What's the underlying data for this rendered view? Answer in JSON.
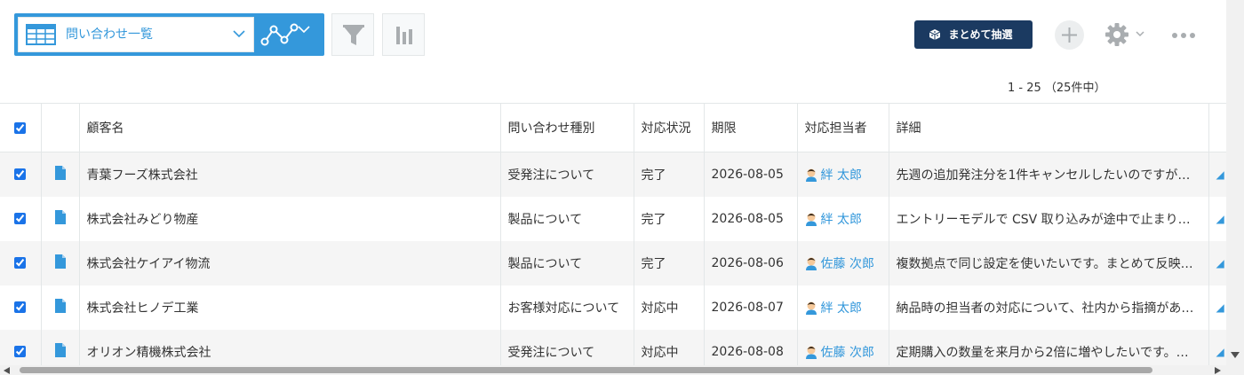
{
  "toolbar": {
    "view_name": "問い合わせ一覧",
    "bulk_lottery_label": "まとめて抽選",
    "icons": {
      "view_list": "table-list-icon",
      "graph": "line-graph-icon",
      "filter": "funnel-icon",
      "chart": "bar-chart-icon",
      "bulk": "dice-icon",
      "add": "plus-icon",
      "settings": "gear-icon",
      "more": "ellipsis-icon"
    },
    "colors": {
      "accent": "#3498db",
      "bulk_button": "#1b3a61"
    }
  },
  "pagination": {
    "text": "1 - 25 （25件中）"
  },
  "table": {
    "headers": {
      "customer": "顧客名",
      "inquiry_type": "問い合わせ種別",
      "status": "対応状況",
      "due_date": "期限",
      "assignee": "対応担当者",
      "details": "詳細"
    },
    "rows": [
      {
        "customer": "青葉フーズ株式会社",
        "inquiry_type": "受発注について",
        "status": "完了",
        "due_date": "2026-08-05",
        "assignee": "絆 太郎",
        "details": "先週の追加発注分を1件キャンセルしたいのですが…"
      },
      {
        "customer": "株式会社みどり物産",
        "inquiry_type": "製品について",
        "status": "完了",
        "due_date": "2026-08-05",
        "assignee": "絆 太郎",
        "details": "エントリーモデルで CSV 取り込みが途中で止まり…"
      },
      {
        "customer": "株式会社ケイアイ物流",
        "inquiry_type": "製品について",
        "status": "完了",
        "due_date": "2026-08-06",
        "assignee": "佐藤 次郎",
        "details": "複数拠点で同じ設定を使いたいです。まとめて反映…"
      },
      {
        "customer": "株式会社ヒノデ工業",
        "inquiry_type": "お客様対応について",
        "status": "対応中",
        "due_date": "2026-08-07",
        "assignee": "絆 太郎",
        "details": "納品時の担当者の対応について、社内から指摘があ…"
      },
      {
        "customer": "オリオン精機株式会社",
        "inquiry_type": "受発注について",
        "status": "対応中",
        "due_date": "2026-08-08",
        "assignee": "佐藤 次郎",
        "details": "定期購入の数量を来月から2倍に増やしたいです。…"
      }
    ]
  }
}
